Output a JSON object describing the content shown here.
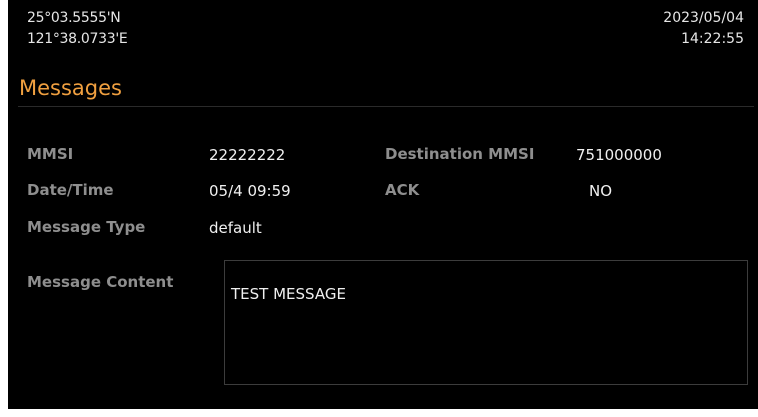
{
  "header": {
    "latitude": "25°03.5555'N",
    "longitude": "121°38.0733'E",
    "date": "2023/05/04",
    "time": "14:22:55"
  },
  "page": {
    "title": "Messages"
  },
  "fields": {
    "mmsi_label": "MMSI",
    "mmsi_value": "22222222",
    "dest_mmsi_label": "Destination MMSI",
    "dest_mmsi_value": "751000000",
    "datetime_label": "Date/Time",
    "datetime_value": "05/4 09:59",
    "ack_label": "ACK",
    "ack_value": "NO",
    "type_label": "Message Type",
    "type_value": "default",
    "content_label": "Message Content",
    "content_value": "TEST MESSAGE"
  },
  "colors": {
    "background": "#000000",
    "title_accent": "#f0a040",
    "label_gray": "#8e8e8e",
    "value_white": "#f0f0f0"
  }
}
